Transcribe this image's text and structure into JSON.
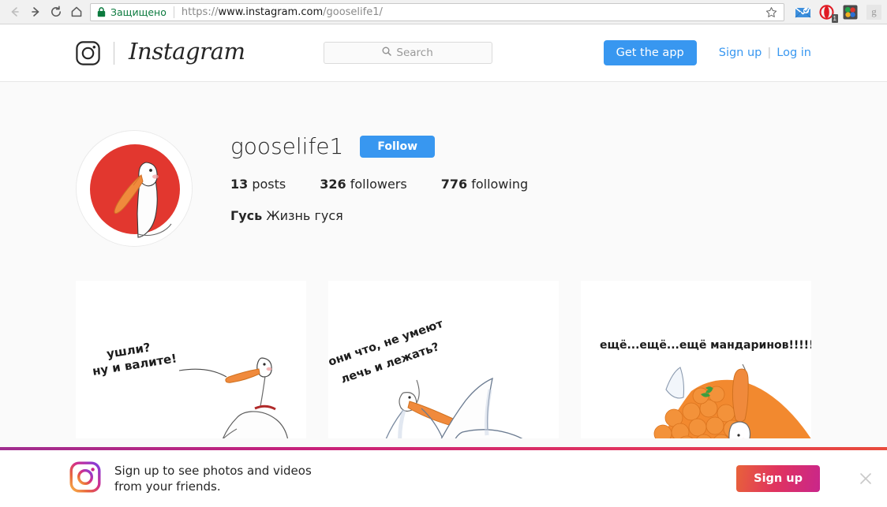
{
  "browser": {
    "back_label": "Back",
    "forward_label": "Forward",
    "reload_label": "Reload",
    "home_label": "Home",
    "security_text": "Защищено",
    "url_scheme": "https://",
    "url_host": "www.instagram.com",
    "url_path": "/gooselife1/",
    "bookmark_label": "Bookmark this page",
    "extensions": [
      {
        "name": "mail-extension-icon",
        "badge": ""
      },
      {
        "name": "opera-extension-icon",
        "badge": "1"
      },
      {
        "name": "colorful-extension-icon",
        "badge": ""
      },
      {
        "name": "google-extension-icon",
        "badge": "",
        "glyph": "g"
      }
    ]
  },
  "header": {
    "brand_name": "Instagram",
    "search_placeholder": "Search",
    "get_app_label": "Get the app",
    "sign_up_label": "Sign up",
    "separator": "|",
    "log_in_label": "Log in",
    "accent_blue": "#3897f0"
  },
  "profile": {
    "username": "gooselife1",
    "follow_label": "Follow",
    "stats": [
      {
        "count": "13",
        "label": "posts"
      },
      {
        "count": "326",
        "label": "followers"
      },
      {
        "count": "776",
        "label": "following"
      }
    ],
    "full_name": "Гусь",
    "bio": "Жизнь гуся",
    "avatar_alt": "goose-avatar-red-circle"
  },
  "posts": [
    {
      "name": "post-thumbnail-1",
      "caption": "ушли?\nну и валите!"
    },
    {
      "name": "post-thumbnail-2",
      "caption": "они что, не умеют\nлечь и лежать?"
    },
    {
      "name": "post-thumbnail-3",
      "caption": "ещё...ещё...ещё мандаринов!!!!!"
    }
  ],
  "banner": {
    "line1": "Sign up to see photos and videos",
    "line2": "from your friends.",
    "signup_label": "Sign up",
    "close_label": "Close"
  }
}
